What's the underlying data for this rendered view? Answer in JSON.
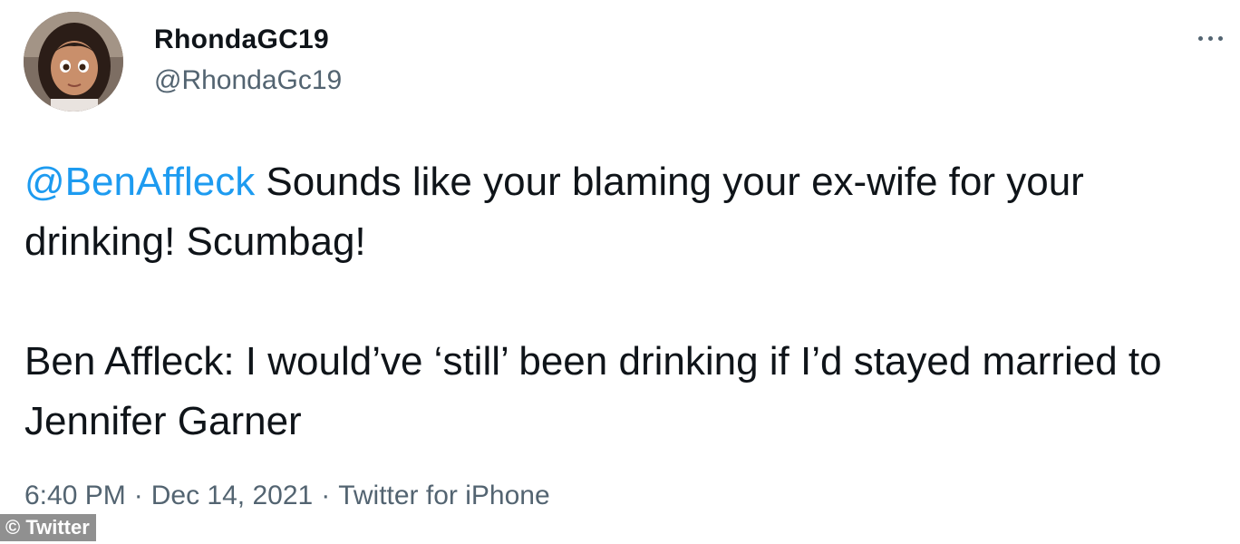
{
  "tweet": {
    "author": {
      "display_name": "RhondaGC19",
      "handle": "@RhondaGc19"
    },
    "mention": "@BenAffleck",
    "reply_text": " Sounds like your blaming your ex-wife for your drinking! Scumbag!",
    "quoted_headline": "Ben Affleck: I would’ve ‘still’ been drinking if I’d stayed married to Jennifer Garner",
    "time": "6:40 PM",
    "date": "Dec 14, 2021",
    "source": "Twitter for iPhone",
    "separator": "·"
  },
  "menu_icon": "more-horizontal-icon",
  "watermark": "© Twitter",
  "colors": {
    "link": "#1d9bf0",
    "text": "#0f1419",
    "secondary": "#536471"
  }
}
